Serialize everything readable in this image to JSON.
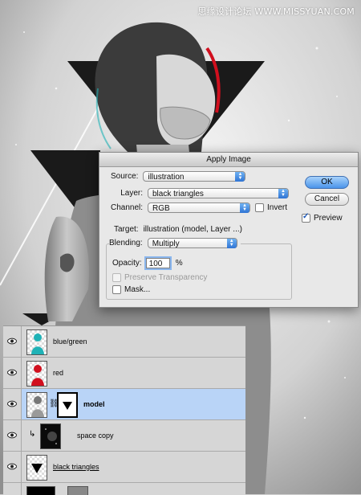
{
  "watermark": "思缘设计论坛 WWW.MISSYUAN.COM",
  "dialog": {
    "title": "Apply Image",
    "source_label": "Source:",
    "source_value": "illustration",
    "layer_label": "Layer:",
    "layer_value": "black triangles",
    "channel_label": "Channel:",
    "channel_value": "RGB",
    "invert_label": "Invert",
    "invert_checked": false,
    "target_label": "Target:",
    "target_value": "illustration (model, Layer ...)",
    "blending_label": "Blending:",
    "blending_value": "Multiply",
    "opacity_label": "Opacity:",
    "opacity_value": "100",
    "opacity_unit": "%",
    "preserve_label": "Preserve Transparency",
    "preserve_enabled": false,
    "mask_label": "Mask...",
    "mask_checked": false,
    "ok_label": "OK",
    "cancel_label": "Cancel",
    "preview_label": "Preview",
    "preview_checked": true
  },
  "layers": [
    {
      "name": "blue/green",
      "visible": true,
      "selected": false,
      "thumb": "blue-green-figure"
    },
    {
      "name": "red",
      "visible": true,
      "selected": false,
      "thumb": "red-figure"
    },
    {
      "name": "model",
      "visible": true,
      "selected": true,
      "thumb": "model-figure",
      "has_mask": true
    },
    {
      "name": "space copy",
      "visible": true,
      "selected": false,
      "thumb": "space-texture",
      "clipped": true
    },
    {
      "name": "black triangles",
      "visible": true,
      "selected": false,
      "thumb": "black-triangle"
    }
  ],
  "colors": {
    "selected_layer": "#b9d4f7",
    "default_button": "#4a94ea",
    "anaglyph_red": "#d10f1e",
    "anaglyph_cyan": "#1fb2b6"
  }
}
